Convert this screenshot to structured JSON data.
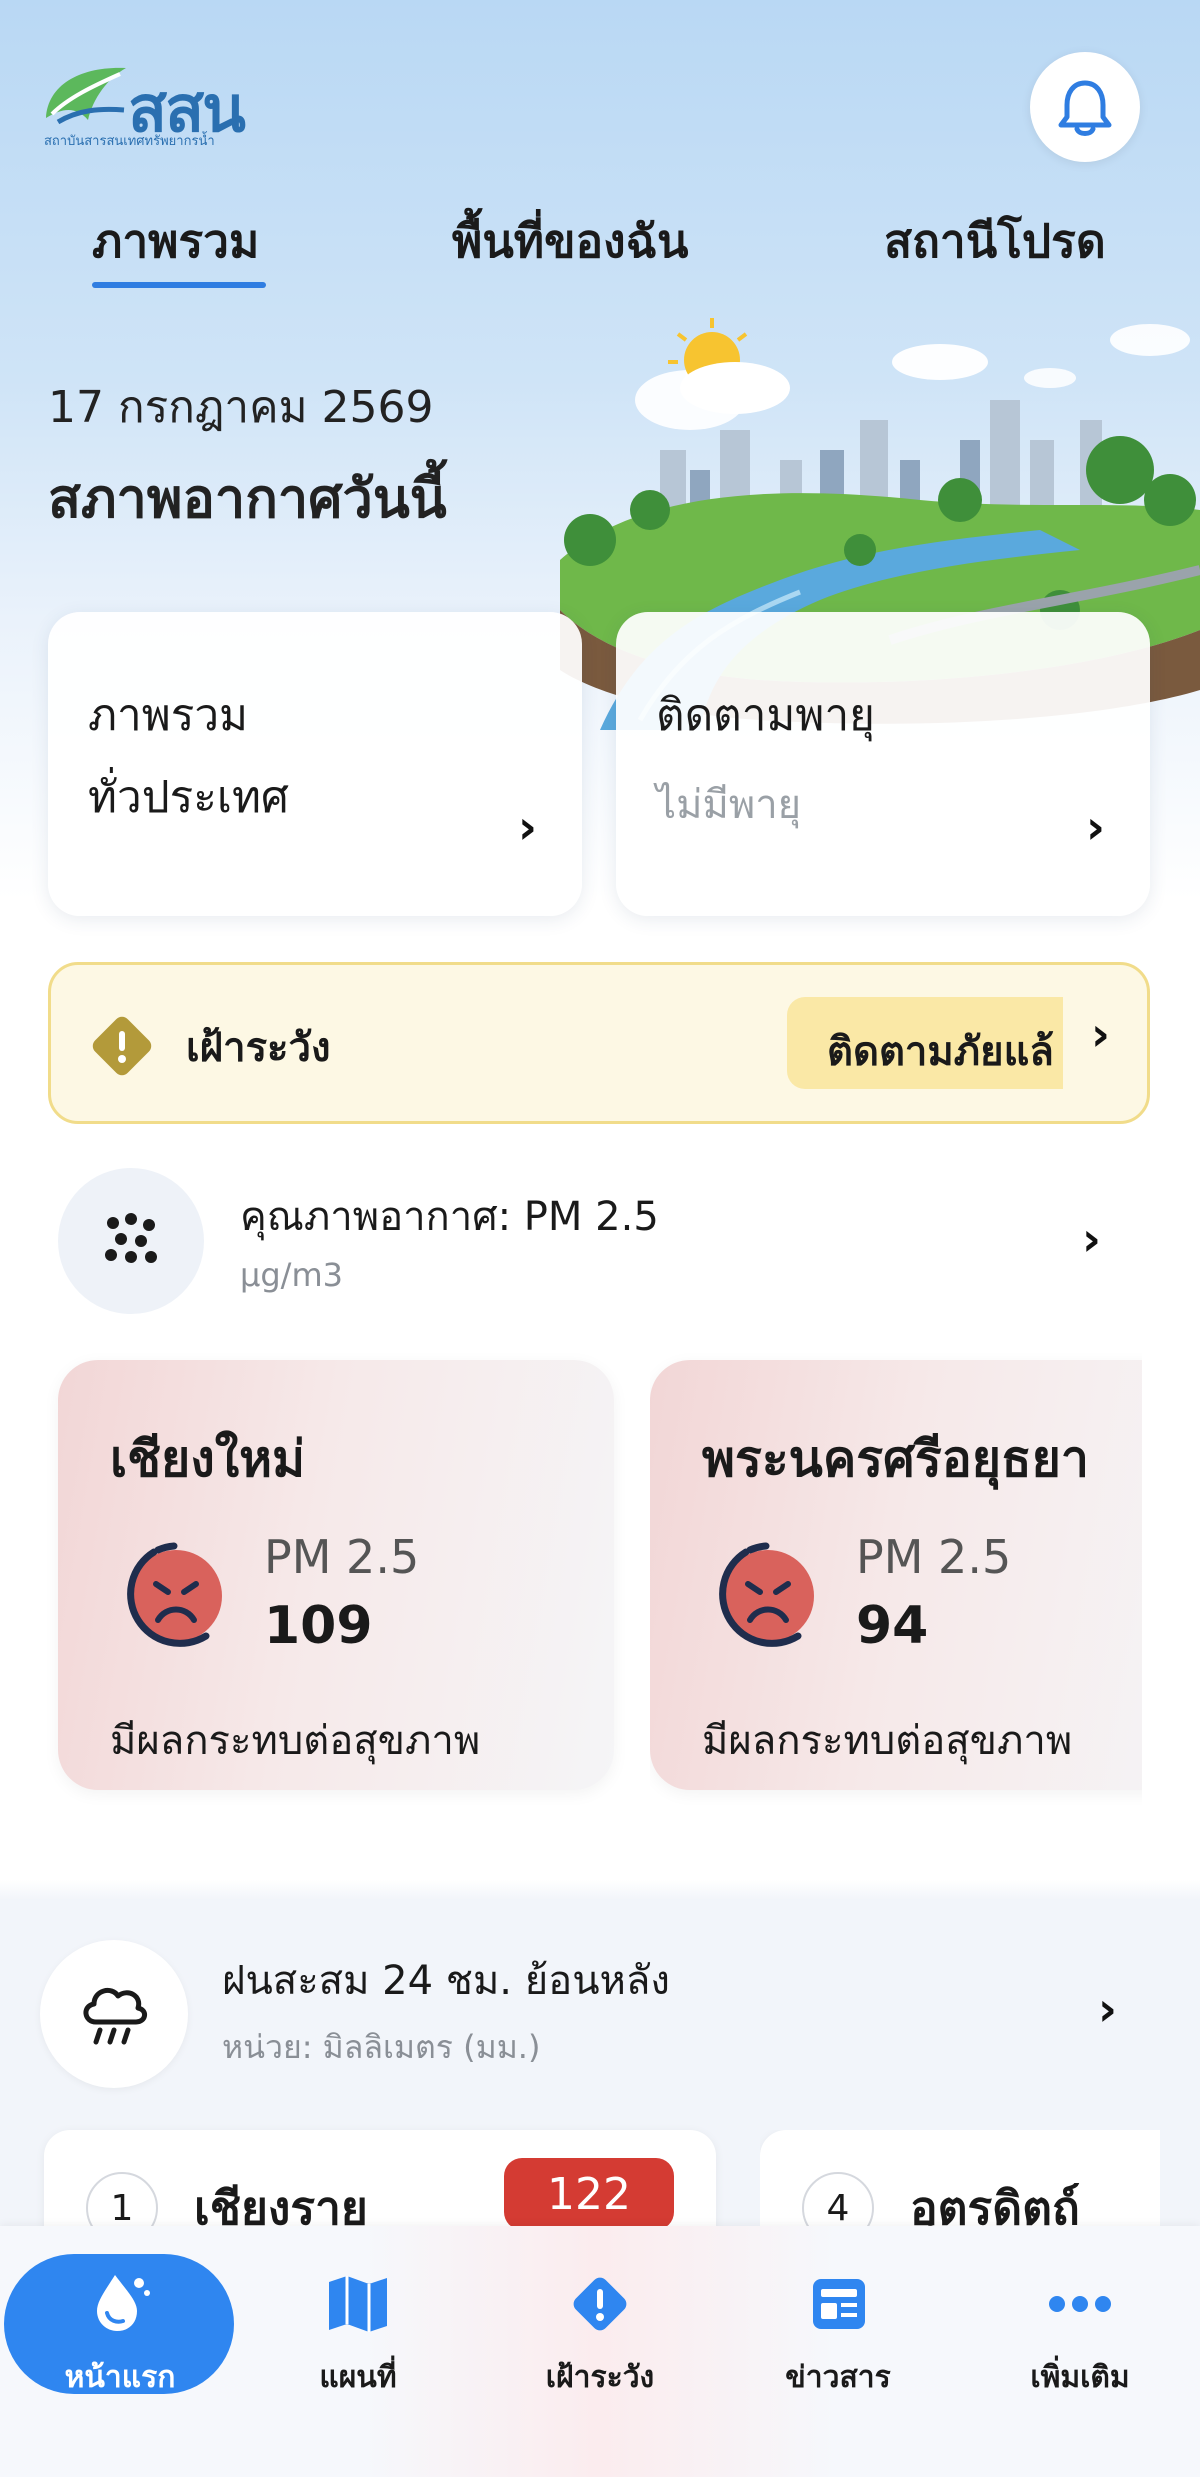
{
  "header": {
    "logo_text": "สสน",
    "logo_subtitle": "สถาบันสารสนเทศทรัพยากรน้ำ",
    "bell_icon": "bell-icon"
  },
  "tabs": [
    {
      "label": "ภาพรวม",
      "active": true
    },
    {
      "label": "พื้นที่ของฉัน",
      "active": false
    },
    {
      "label": "สถานีโปรด",
      "active": false
    }
  ],
  "date": "17 กรกฎาคม 2569",
  "weather_title": "สภาพอากาศวันนี้",
  "cards": {
    "overview": {
      "title_line1": "ภาพรวม",
      "title_line2": "ทั่วประเทศ"
    },
    "storm": {
      "title": "ติดตามพายุ",
      "subtitle": "ไม่มีพายุ"
    }
  },
  "alert": {
    "label": "เฝ้าระวัง",
    "button": "ติดตามภัยแล้",
    "color": "#fdf8e4"
  },
  "pm_section": {
    "title": "คุณภาพอากาศ: PM 2.5",
    "unit": "μg/m3",
    "cards": [
      {
        "city": "เชียงใหม่",
        "label": "PM 2.5",
        "value": "109",
        "status": "มีผลกระทบต่อสุขภาพ"
      },
      {
        "city": "พระนครศรีอยุธยา",
        "label": "PM 2.5",
        "value": "94",
        "status": "มีผลกระทบต่อสุขภาพ"
      }
    ]
  },
  "rain_section": {
    "title": "ฝนสะสม 24 ชม. ย้อนหลัง",
    "unit": "หน่วย: มิลลิเมตร (มม.)",
    "items": [
      {
        "rank": "1",
        "name": "เชียงราย",
        "value": "122"
      },
      {
        "rank": "4",
        "name": "อุตรดิตถ์",
        "value": ""
      }
    ]
  },
  "bottom_nav": [
    {
      "label": "หน้าแรก",
      "icon": "water-drop-icon",
      "active": true
    },
    {
      "label": "แผนที่",
      "icon": "map-icon",
      "active": false
    },
    {
      "label": "เฝ้าระวัง",
      "icon": "alert-icon",
      "active": false
    },
    {
      "label": "ข่าวสาร",
      "icon": "news-icon",
      "active": false
    },
    {
      "label": "เพิ่มเติม",
      "icon": "more-icon",
      "active": false
    }
  ]
}
